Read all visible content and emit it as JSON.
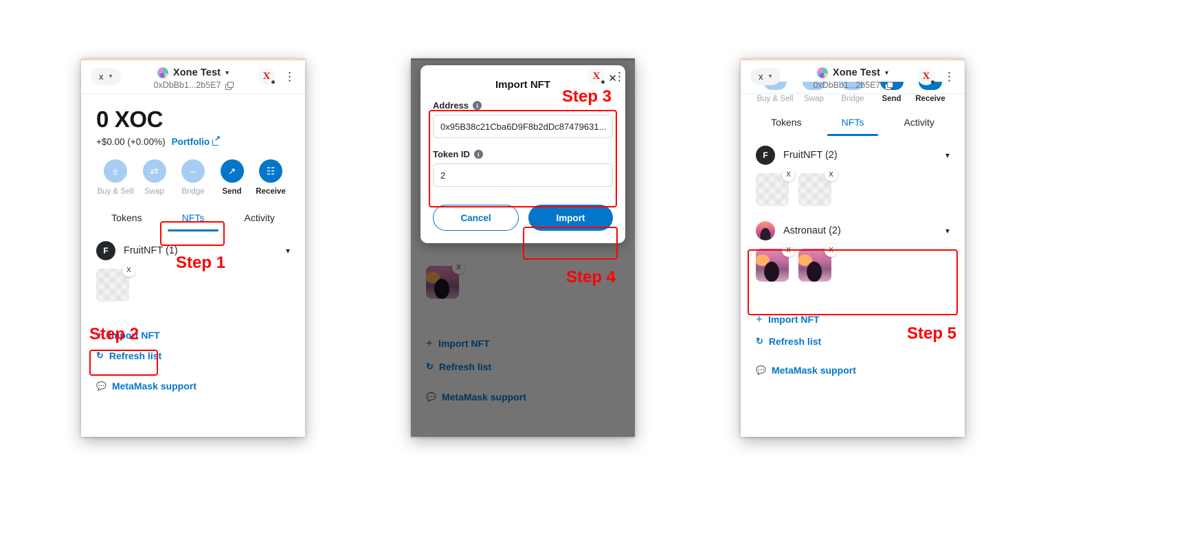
{
  "wallet": {
    "network_pill": "x",
    "account_name": "Xone Test",
    "account_address": "0xDbBb1...2b5E7",
    "balance": "0 XOC",
    "change": "+$0.00 (+0.00%)",
    "portfolio_label": "Portfolio",
    "actions": [
      {
        "label": "Buy & Sell",
        "icon": "plus-minus-icon",
        "glyph": "±",
        "active": false
      },
      {
        "label": "Swap",
        "icon": "swap-arrows-icon",
        "glyph": "⇄",
        "active": false
      },
      {
        "label": "Bridge",
        "icon": "bridge-arc-icon",
        "glyph": "⌒",
        "active": false
      },
      {
        "label": "Send",
        "icon": "send-arrow-icon",
        "glyph": "↗",
        "active": true
      },
      {
        "label": "Receive",
        "icon": "qr-code-icon",
        "glyph": "☷",
        "active": true
      }
    ],
    "tabs": [
      {
        "label": "Tokens",
        "active": false
      },
      {
        "label": "NFTs",
        "active": true
      },
      {
        "label": "Activity",
        "active": false
      }
    ],
    "import_nft_label": "Import NFT",
    "refresh_label": "Refresh list",
    "support_label": "MetaMask support"
  },
  "panel1": {
    "collection_name": "FruitNFT (1)",
    "collection_badge": "F",
    "nfts": [
      {
        "remove": "X"
      }
    ],
    "steps": [
      {
        "id": "step1",
        "label": "Step 1"
      },
      {
        "id": "step2",
        "label": "Step 2"
      }
    ]
  },
  "panel2": {
    "modal": {
      "title": "Import NFT",
      "close": "✕",
      "address_label": "Address",
      "address_value": "0x95B38c21Cba6D9F8b2dDc87479631...",
      "token_id_label": "Token ID",
      "token_id_value": "2",
      "cancel_label": "Cancel",
      "import_label": "Import"
    },
    "steps": [
      {
        "id": "step3",
        "label": "Step 3"
      },
      {
        "id": "step4",
        "label": "Step 4"
      }
    ]
  },
  "panel3": {
    "collections": [
      {
        "name": "FruitNFT (2)",
        "badge": "F",
        "kind": "placeholder",
        "count": 2
      },
      {
        "name": "Astronaut (2)",
        "badge": "",
        "kind": "astronaut",
        "count": 2
      }
    ],
    "remove_glyph": "X",
    "steps": [
      {
        "id": "step5",
        "label": "Step 5"
      }
    ]
  },
  "colors": {
    "accent": "#0376c9",
    "accent_dim": "#a7cdf2",
    "highlight": "#ff0000",
    "text": "#24272a",
    "muted": "#6a737d"
  }
}
